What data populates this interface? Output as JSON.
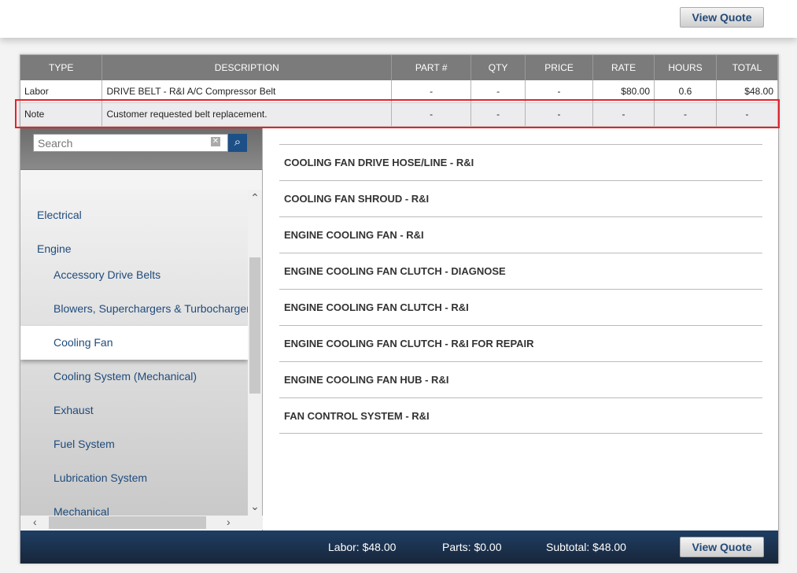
{
  "top": {
    "view_quote": "View Quote"
  },
  "table": {
    "headers": [
      "TYPE",
      "DESCRIPTION",
      "PART #",
      "QTY",
      "PRICE",
      "RATE",
      "HOURS",
      "TOTAL"
    ],
    "rows": [
      [
        "Labor",
        "DRIVE BELT - R&I A/C Compressor Belt",
        "-",
        "-",
        "-",
        "$80.00",
        "0.6",
        "$48.00"
      ],
      [
        "Note",
        "Customer requested belt replacement.",
        "-",
        "-",
        "-",
        "-",
        "-",
        "-"
      ]
    ]
  },
  "sidebar": {
    "search_placeholder": "Search",
    "items": [
      {
        "label": "Electrical"
      },
      {
        "label": "Engine"
      },
      {
        "label": "Accessory Drive Belts"
      },
      {
        "label": "Blowers, Superchargers & Turbochargers"
      },
      {
        "label": "Cooling Fan"
      },
      {
        "label": "Cooling System (Mechanical)"
      },
      {
        "label": "Exhaust"
      },
      {
        "label": "Fuel System"
      },
      {
        "label": "Lubrication System"
      },
      {
        "label": "Mechanical"
      }
    ]
  },
  "operations": [
    "COOLING FAN DRIVE HOSE/LINE - R&I",
    "COOLING FAN SHROUD - R&I",
    "ENGINE COOLING FAN - R&I",
    "ENGINE COOLING FAN CLUTCH - DIAGNOSE",
    "ENGINE COOLING FAN CLUTCH - R&I",
    "ENGINE COOLING FAN CLUTCH - R&I FOR REPAIR",
    "ENGINE COOLING FAN HUB - R&I",
    "FAN CONTROL SYSTEM - R&I"
  ],
  "footer": {
    "labor": "Labor: $48.00",
    "parts": "Parts: $0.00",
    "subtotal": "Subtotal: $48.00",
    "view_quote": "View Quote"
  }
}
